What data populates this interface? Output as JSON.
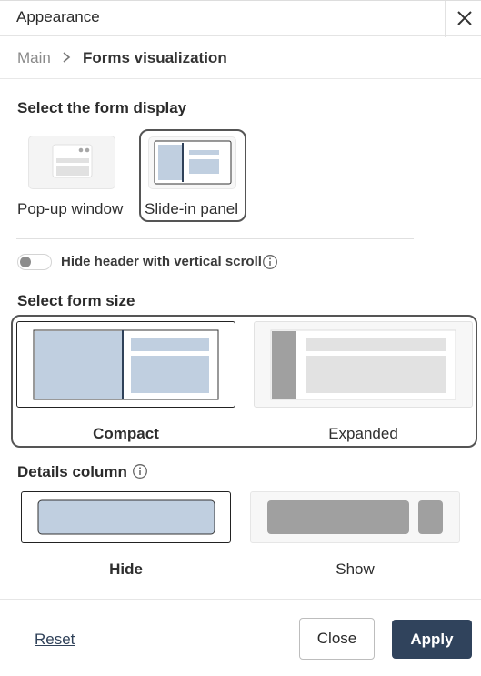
{
  "header": {
    "title": "Appearance",
    "close_icon": "close-icon"
  },
  "breadcrumb": {
    "items": [
      "Main",
      "Forms visualization"
    ],
    "separator_icon": "chevron-right-icon"
  },
  "form_display": {
    "title": "Select the form display",
    "options": [
      {
        "label": "Pop-up window",
        "selected": false
      },
      {
        "label": "Slide-in panel",
        "selected": true
      }
    ]
  },
  "hide_header": {
    "label": "Hide header with vertical scroll",
    "enabled": false,
    "info_icon": "info-icon"
  },
  "form_size": {
    "title": "Select form size",
    "options": [
      {
        "label": "Compact",
        "selected": true
      },
      {
        "label": "Expanded",
        "selected": false
      }
    ]
  },
  "details_column": {
    "title": "Details column",
    "info_icon": "info-icon",
    "options": [
      {
        "label": "Hide",
        "selected": true
      },
      {
        "label": "Show",
        "selected": false
      }
    ]
  },
  "footer": {
    "reset_label": "Reset",
    "close_label": "Close",
    "apply_label": "Apply"
  },
  "colors": {
    "accent": "#30435c",
    "preview_blue": "#c0cfe0",
    "preview_gray": "#a0a0a0",
    "selection_outline": "#555555"
  }
}
